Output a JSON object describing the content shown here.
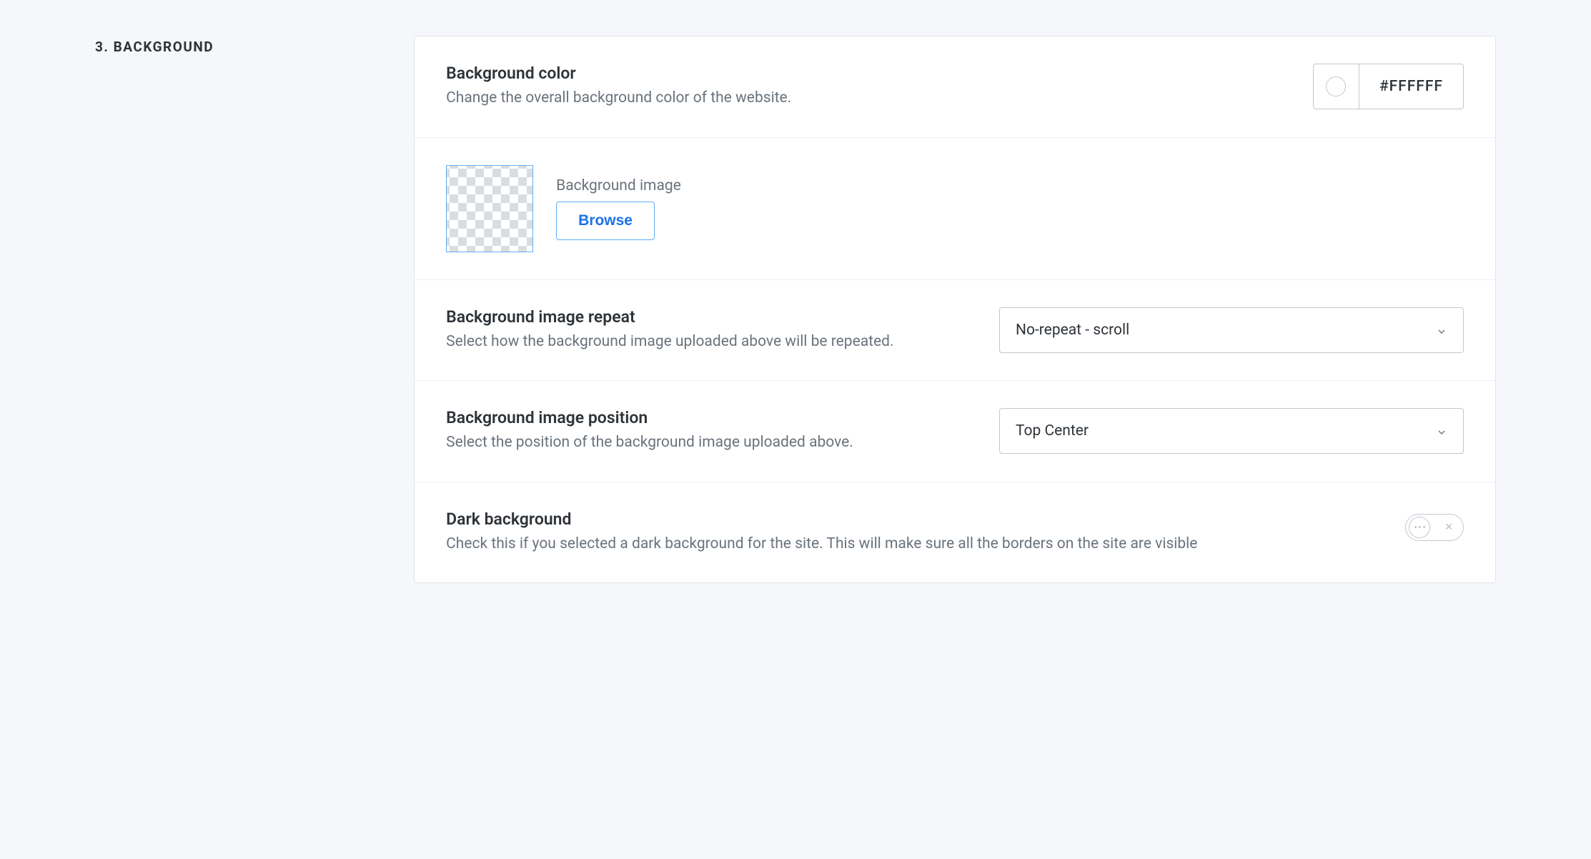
{
  "section": {
    "number": "3.",
    "title": "BACKGROUND"
  },
  "bgColor": {
    "title": "Background color",
    "description": "Change the overall background color of the website.",
    "hex": "#FFFFFF"
  },
  "bgImage": {
    "label": "Background image",
    "browse": "Browse"
  },
  "repeat": {
    "title": "Background image repeat",
    "description": "Select how the background image uploaded above will be repeated.",
    "value": "No-repeat - scroll"
  },
  "position": {
    "title": "Background image position",
    "description": "Select the position of the background image uploaded above.",
    "value": "Top Center"
  },
  "dark": {
    "title": "Dark background",
    "description": "Check this if you selected a dark background for the site. This will make sure all the borders on the site are visible",
    "enabled": false
  }
}
